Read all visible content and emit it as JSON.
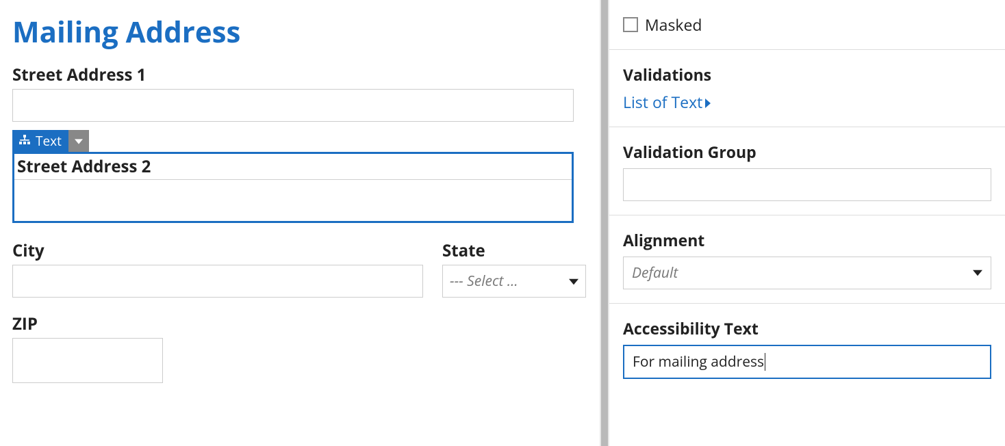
{
  "form": {
    "title": "Mailing Address",
    "street1_label": "Street Address 1",
    "street2_label": "Street Address 2",
    "city_label": "City",
    "state_label": "State",
    "state_placeholder": "--- Select ...",
    "zip_label": "ZIP"
  },
  "selection": {
    "tag_text": "Text"
  },
  "panel": {
    "masked_label": "Masked",
    "masked_checked": false,
    "validations_label": "Validations",
    "validations_link": "List of Text",
    "validation_group_label": "Validation Group",
    "validation_group_value": "",
    "alignment_label": "Alignment",
    "alignment_value": "Default",
    "accessibility_label": "Accessibility Text",
    "accessibility_value": "For mailing address"
  }
}
